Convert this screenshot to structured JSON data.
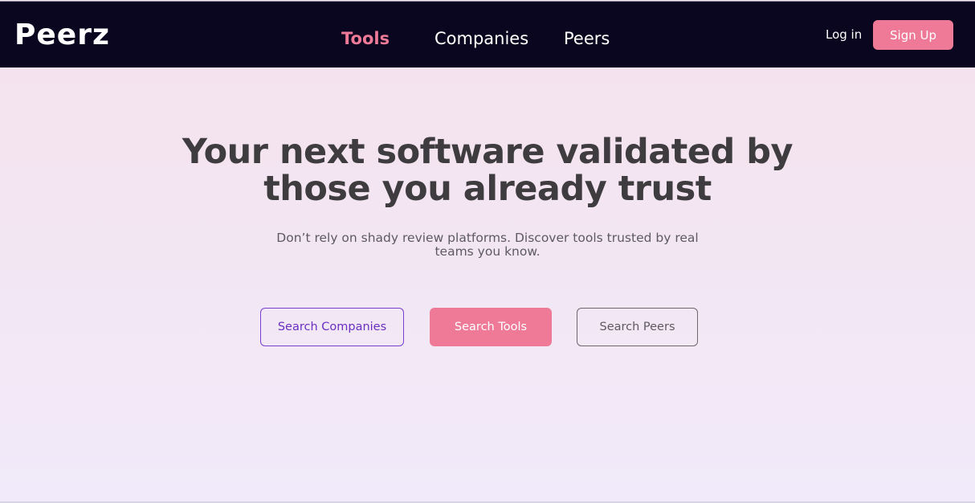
{
  "brand": {
    "logo_text": "Peerz"
  },
  "nav": {
    "items": [
      {
        "label": "Tools",
        "active": true
      },
      {
        "label": "Companies",
        "active": false
      },
      {
        "label": "Peers",
        "active": false
      }
    ]
  },
  "auth": {
    "login_label": "Log in",
    "signup_label": "Sign Up"
  },
  "hero": {
    "headline_line1": "Your next software validated by",
    "headline_line2": "those you already trust",
    "subtitle_line1": "Don’t rely on shady review platforms. Discover tools trusted by real",
    "subtitle_line2": "teams you know."
  },
  "actions": {
    "search_companies": "Search Companies",
    "search_tools": "Search Tools",
    "search_peers": "Search Peers"
  },
  "colors": {
    "topbar_bg": "#0b0620",
    "accent_pink": "#ee7a97",
    "accent_purple": "#7a3fd1",
    "headline": "#3f3c40"
  }
}
